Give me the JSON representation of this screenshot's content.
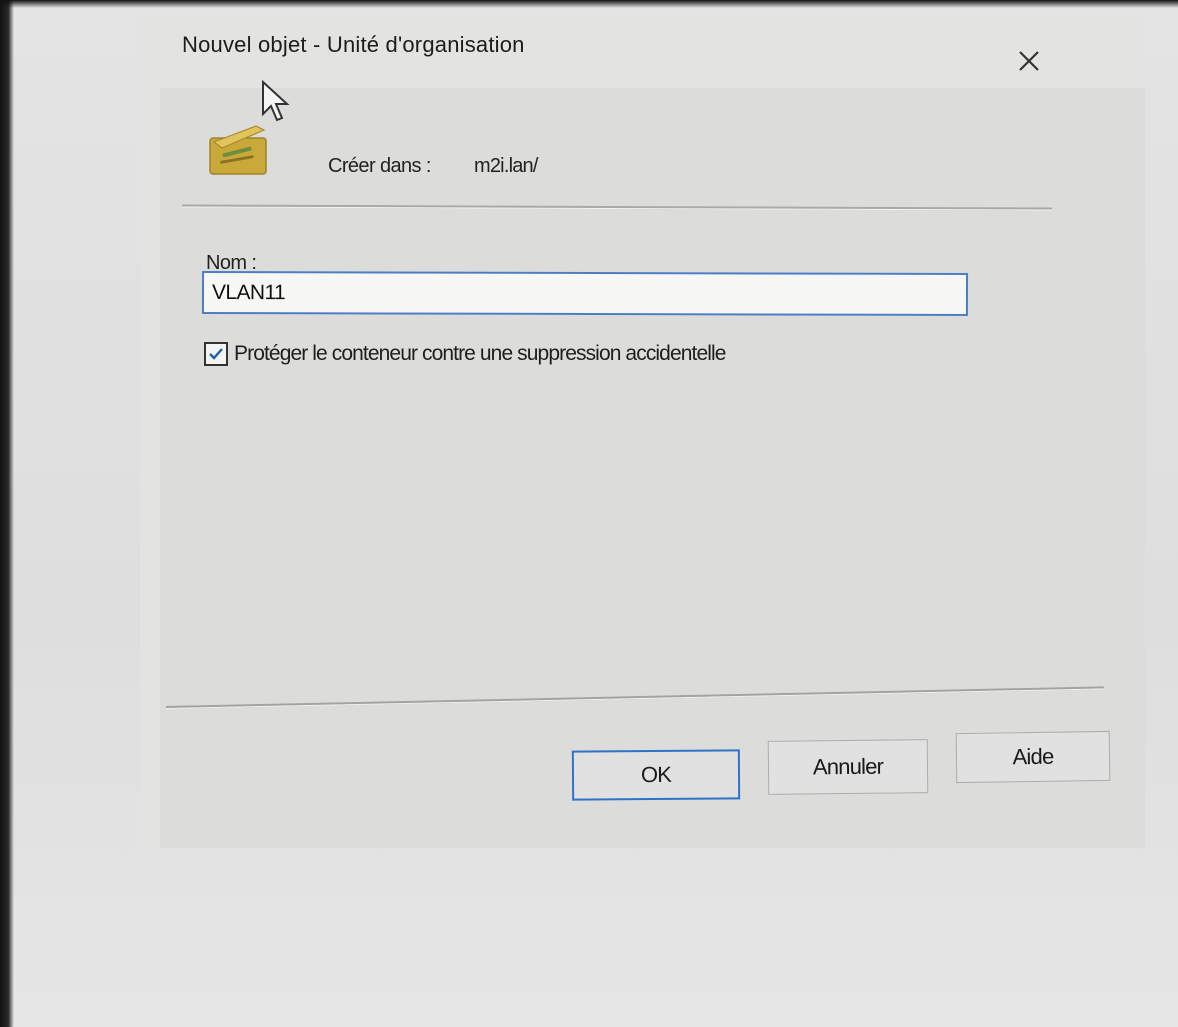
{
  "dialog": {
    "title": "Nouvel objet - Unité d'organisation",
    "close_icon": "close-icon"
  },
  "header": {
    "icon": "organizational-unit-icon",
    "create_label": "Créer dans :",
    "create_path": "m2i.lan/"
  },
  "form": {
    "name_label": "Nom :",
    "name_value": "VLAN11",
    "protect_checked": true,
    "protect_label": "Protéger le conteneur contre une suppression accidentelle"
  },
  "buttons": {
    "ok_label": "OK",
    "cancel_label": "Annuler",
    "help_label": "Aide"
  },
  "colors": {
    "focus_accent": "#2f73c8",
    "ou_icon": "#c9a93a"
  }
}
